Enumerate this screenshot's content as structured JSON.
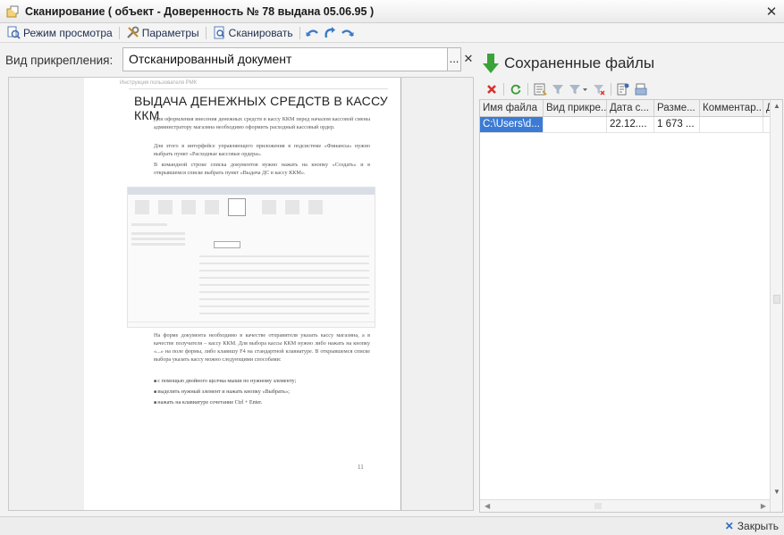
{
  "window": {
    "title": "Сканирование ( объект - Доверенность  № 78 выдана 05.06.95 )",
    "close_glyph": "✕"
  },
  "toolbar": {
    "view_mode_label": "Режим просмотра",
    "params_label": "Параметры",
    "scan_label": "Сканировать"
  },
  "attach": {
    "label": "Вид прикрепления:",
    "value": "Отсканированный документ",
    "select_glyph": "...",
    "clear_glyph": "✕"
  },
  "preview_doc": {
    "header": "Инструкция пользователя РМК",
    "title": "ВЫДАЧА ДЕНЕЖНЫХ СРЕДСТВ В КАССУ ККМ",
    "paragraphs": [
      "Для оформления внесения денежных средств в кассу ККМ перед началом кассовой смены администратору магазина необходимо оформить расходный кассовый ордер.",
      "Для этого в интерфейсе управляющего приложения в подсистеме «Финансы» нужно выбрать пункт «Расходные кассовые ордера».",
      "В командной строке списка документов нужно нажать на кнопку «Создать» и в открывшемся списке выбрать пункт «Выдача ДС в кассу ККМ».",
      "На форме документа необходимо в качестве отправителя указать кассу магазина, а в качестве получателя – кассу ККМ. Для выбора кассы ККМ нужно либо нажать на кнопку «...» на поле формы, либо клавишу F4 на стандартной клавиатуре. В открывшемся списке выбора указать кассу можно следующими способами:"
    ],
    "bullets": [
      "с помощью двойного щелчка мыши по нужному элементу;",
      "выделить нужный элемент и нажать кнопку «Выбрать»;",
      "нажать на клавиатуре сочетание Ctrl + Enter."
    ],
    "page_number": "11"
  },
  "saved_files": {
    "title": "Сохраненные файлы",
    "columns": [
      "Имя файла",
      "Вид прикре...",
      "Дата с...",
      "Разме...",
      "Комментар...",
      "Д"
    ],
    "rows": [
      [
        "C:\\Users\\d...",
        "",
        "22.12....",
        "1 673 ...",
        "",
        ""
      ]
    ]
  },
  "footer": {
    "close_label": "Закрыть"
  },
  "colors": {
    "selection": "#3b7bd5",
    "delete_red": "#d8312b",
    "refresh_green": "#3a9a3a",
    "accent_blue": "#2e6fbf"
  }
}
